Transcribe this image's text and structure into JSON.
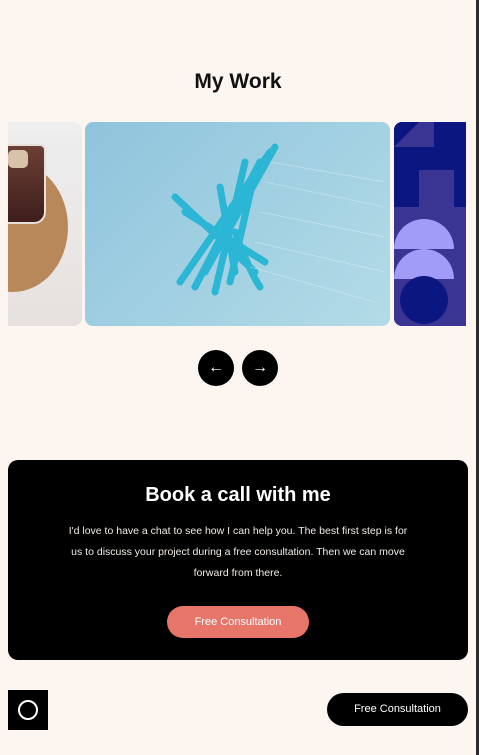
{
  "section": {
    "title": "My Work"
  },
  "carousel": {
    "slides": [
      "iced-coffee-image",
      "blue-sculpture-image",
      "geometric-pattern-image"
    ],
    "prev_icon": "←",
    "next_icon": "→"
  },
  "cta": {
    "heading": "Book a call with me",
    "body": "I'd love to have a chat to see how I can help you. The best first step is for us to discuss your project during a free consultation. Then we can move forward from there.",
    "button": "Free Consultation",
    "accent": "#e8756a"
  },
  "footer": {
    "button": "Free Consultation"
  }
}
